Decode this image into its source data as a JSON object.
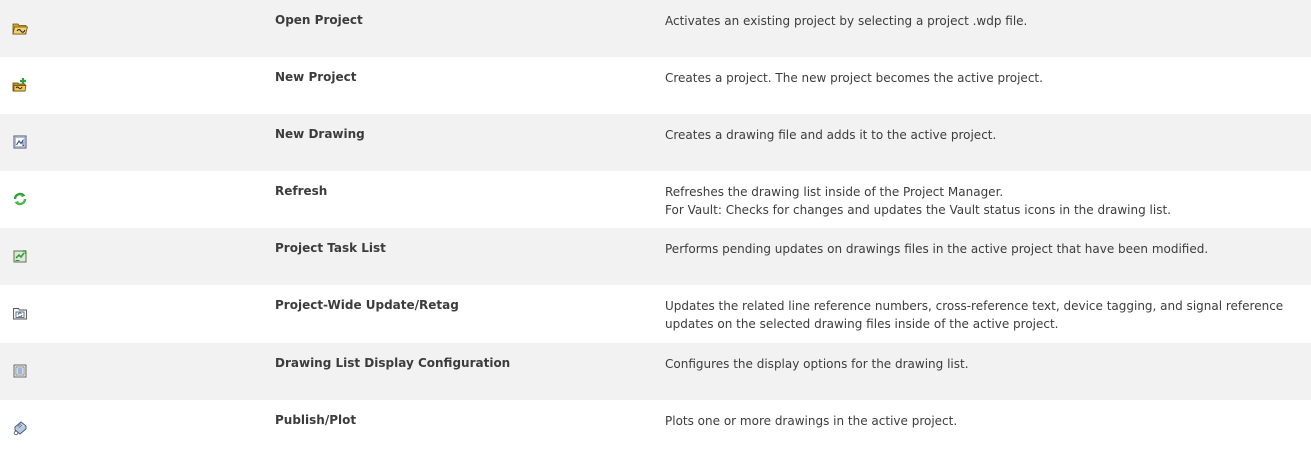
{
  "rows": [
    {
      "icon": "open-folder-icon",
      "name": "Open Project",
      "desc": [
        "Activates an existing project by selecting a project .wdp file."
      ]
    },
    {
      "icon": "new-project-icon",
      "name": "New Project",
      "desc": [
        "Creates a project. The new project becomes the active project."
      ]
    },
    {
      "icon": "new-drawing-icon",
      "name": "New Drawing",
      "desc": [
        "Creates a drawing file and adds it to the active project."
      ]
    },
    {
      "icon": "refresh-icon",
      "name": "Refresh",
      "desc": [
        "Refreshes the drawing list inside of the Project Manager.",
        "For Vault: Checks for changes and updates the Vault status icons in the drawing list."
      ]
    },
    {
      "icon": "task-list-icon",
      "name": "Project Task List",
      "desc": [
        "Performs pending updates on drawings files in the active project that have been modified."
      ]
    },
    {
      "icon": "project-update-icon",
      "name": "Project-Wide Update/Retag",
      "desc": [
        "Updates the related line reference numbers, cross-reference text, device tagging, and signal reference updates on the selected drawing files inside of the active project."
      ]
    },
    {
      "icon": "display-config-icon",
      "name": "Drawing List Display Configuration",
      "desc": [
        "Configures the display options for the drawing list."
      ]
    },
    {
      "icon": "publish-plot-icon",
      "name": "Publish/Plot",
      "desc": [
        "Plots one or more drawings in the active project."
      ]
    }
  ]
}
